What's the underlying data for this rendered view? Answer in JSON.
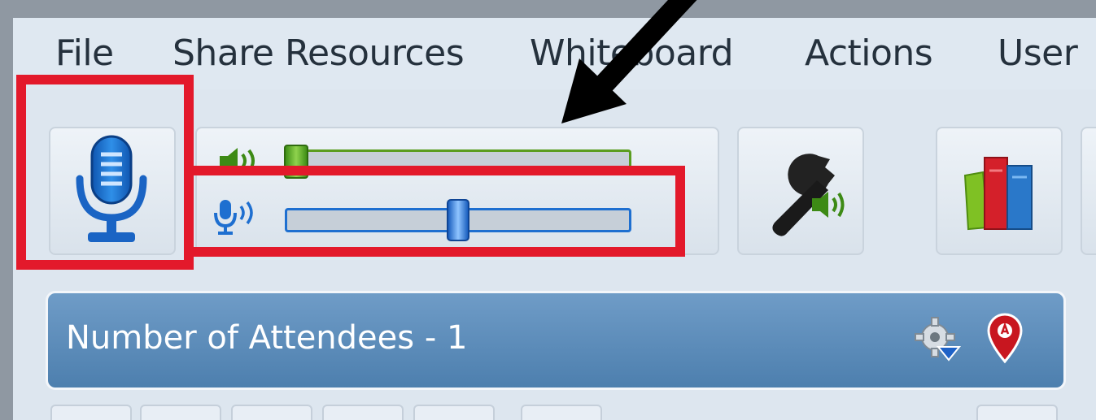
{
  "menu": {
    "items": [
      {
        "label": "File"
      },
      {
        "label": "Share Resources"
      },
      {
        "label": "Whiteboard"
      },
      {
        "label": "Actions"
      },
      {
        "label": "User"
      }
    ]
  },
  "toolbar": {
    "speaker_volume_level": 0.04,
    "mic_volume_level": 0.5
  },
  "attendees_panel": {
    "title": "Number of Attendees - 1"
  },
  "colors": {
    "highlight_red": "#e3192b",
    "speaker_green": "#5a9d1f",
    "mic_blue": "#1e6fd0",
    "panel_blue": "#5b8bb9"
  },
  "icons": {
    "microphone": "microphone-icon",
    "speaker": "speaker-icon",
    "audio_settings": "wrench-speaker-icon",
    "library": "books-icon",
    "settings": "gear-dropdown-icon",
    "location": "map-pin-icon"
  }
}
